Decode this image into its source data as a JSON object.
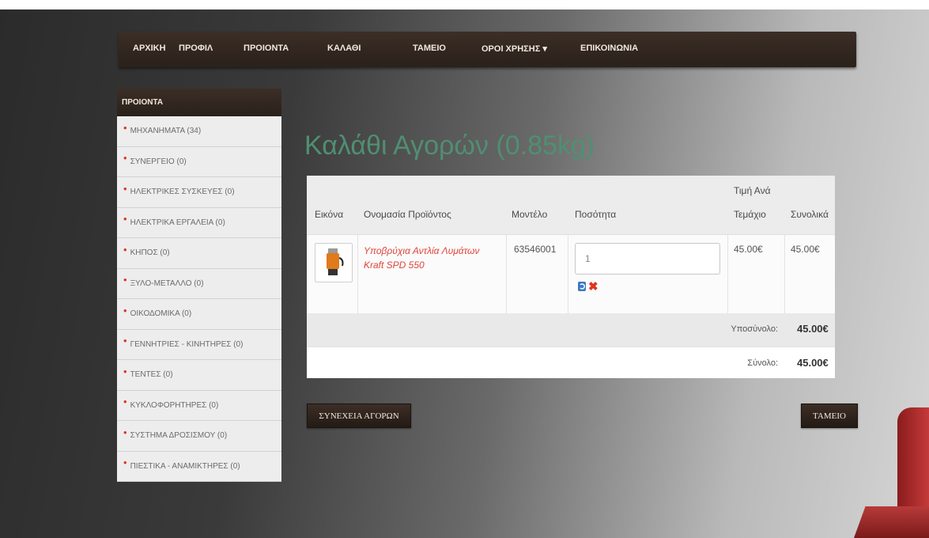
{
  "nav": {
    "items": [
      {
        "label": "ΑΡΧΙΚΗ"
      },
      {
        "label": "ΠΡΟΦΙΛ"
      },
      {
        "label": "ΠΡΟΙΟΝΤΑ"
      },
      {
        "label": "ΚΑΛΑΘΙ"
      },
      {
        "label": "ΤΑΜΕΙΟ"
      },
      {
        "label": "ΟΡΟΙ ΧΡΗΣΗΣ ▾"
      },
      {
        "label": "ΕΠΙΚΟΙΝΩΝΙΑ"
      }
    ]
  },
  "sidebar": {
    "title": "ΠΡΟΙΟΝΤΑ",
    "items": [
      {
        "label": "ΜΗΧΑΝΗΜΑΤΑ (34)"
      },
      {
        "label": "ΣΥΝΕΡΓΕΙΟ (0)"
      },
      {
        "label": "ΗΛΕΚΤΡΙΚΕΣ ΣΥΣΚΕΥΕΣ (0)"
      },
      {
        "label": "ΗΛΕΚΤΡΙΚΑ ΕΡΓΑΛΕΙΑ (0)"
      },
      {
        "label": "ΚΗΠΟΣ (0)"
      },
      {
        "label": "ΞΥΛΟ-ΜΕΤΑΛΛΟ (0)"
      },
      {
        "label": "ΟΙΚΟΔΟΜΙΚΑ (0)"
      },
      {
        "label": "ΓΕΝΝΗΤΡΙΕΣ - ΚΙΝΗΤΗΡΕΣ (0)"
      },
      {
        "label": "ΤΕΝΤΕΣ (0)"
      },
      {
        "label": "ΚΥΚΛΟΦΟΡΗΤΗΡΕΣ (0)"
      },
      {
        "label": "ΣΥΣΤΗΜΑ ΔΡΟΣΙΣΜΟΥ (0)"
      },
      {
        "label": "ΠΙΕΣΤΙΚΑ - ΑΝΑΜΙΚΤΗΡΕΣ (0)"
      }
    ]
  },
  "main": {
    "title": "Καλάθι Αγορών (0.85kg)"
  },
  "cart": {
    "headers": {
      "image": "Εικόνα",
      "name": "Ονομασία Προϊόντος",
      "model": "Μοντέλο",
      "quantity": "Ποσότητα",
      "unit_price_line1": "Τιμή Ανά",
      "unit_price_line2": "Τεμάχιο",
      "total": "Συνολικά"
    },
    "items": [
      {
        "name_line1": "Υποβρύχια Αντλία Λυμάτων",
        "name_line2": "Kraft SPD 550",
        "model": "63546001",
        "quantity": "1",
        "unit_price": "45.00€",
        "total": "45.00€"
      }
    ],
    "subtotal_label": "Υποσύνολο:",
    "subtotal_value": "45.00€",
    "total_label": "Σύνολο:",
    "total_value": "45.00€"
  },
  "buttons": {
    "continue": "ΣΥΝΕΧΕΙΑ ΑΓΟΡΩΝ",
    "checkout": "ΤΑΜΕΙΟ"
  },
  "icons": {
    "update": "refresh-icon",
    "remove": "remove-icon",
    "bullet": "bullet-icon"
  },
  "colors": {
    "title_green": "#4f8f73",
    "nav_brown": "#2a211b",
    "link_red": "#e0443a",
    "bullet_red": "#e0341f"
  }
}
